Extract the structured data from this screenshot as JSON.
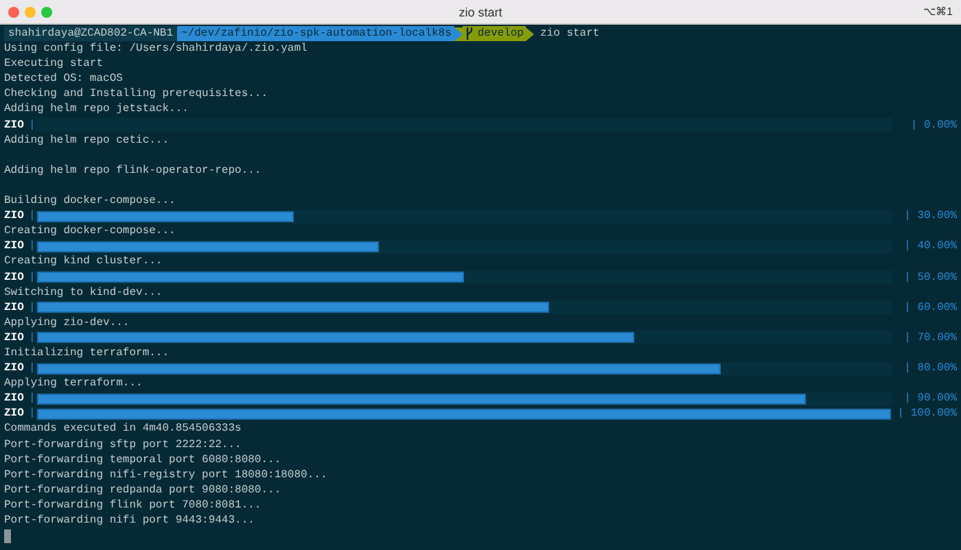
{
  "window": {
    "title": "zio start",
    "shortcut": "⌥⌘1"
  },
  "prompt": {
    "user": "shahirdaya@ZCAD802-CA-NB1",
    "path": "~/dev/zafinio/zio-spk-automation-localk8s",
    "branch": "develop",
    "command": "zio start"
  },
  "lines": [
    {
      "kind": "text",
      "text": "Using config file: /Users/shahirdaya/.zio.yaml"
    },
    {
      "kind": "text",
      "text": "Executing start"
    },
    {
      "kind": "text",
      "text": "Detected OS: macOS"
    },
    {
      "kind": "text",
      "text": "Checking and Installing prerequisites..."
    },
    {
      "kind": "text",
      "text": "Adding helm repo jetstack..."
    },
    {
      "kind": "progress",
      "label": "ZIO",
      "open": "|",
      "level": 0,
      "reading": "| 0.00%"
    },
    {
      "kind": "text",
      "text": "Adding helm repo cetic..."
    },
    {
      "kind": "blank"
    },
    {
      "kind": "text",
      "text": "Adding helm repo flink-operator-repo..."
    },
    {
      "kind": "blank"
    },
    {
      "kind": "text",
      "text": "Building docker-compose..."
    },
    {
      "kind": "progress",
      "label": "ZIO",
      "open": "|",
      "level": 0.3,
      "reading": "| 30.00%"
    },
    {
      "kind": "text",
      "text": "Creating docker-compose..."
    },
    {
      "kind": "progress",
      "label": "ZIO",
      "open": "|",
      "level": 0.4,
      "reading": "| 40.00%"
    },
    {
      "kind": "text",
      "text": "Creating kind cluster..."
    },
    {
      "kind": "progress",
      "label": "ZIO",
      "open": "|",
      "level": 0.5,
      "reading": "| 50.00%"
    },
    {
      "kind": "text",
      "text": "Switching to kind-dev..."
    },
    {
      "kind": "progress",
      "label": "ZIO",
      "open": "|",
      "level": 0.6,
      "reading": "| 60.00%"
    },
    {
      "kind": "text",
      "text": "Applying zio-dev..."
    },
    {
      "kind": "progress",
      "label": "ZIO",
      "open": "|",
      "level": 0.7,
      "reading": "| 70.00%"
    },
    {
      "kind": "text",
      "text": "Initializing terraform..."
    },
    {
      "kind": "progress",
      "label": "ZIO",
      "open": "|",
      "level": 0.8,
      "reading": "| 80.00%"
    },
    {
      "kind": "text",
      "text": "Applying terraform..."
    },
    {
      "kind": "progress",
      "label": "ZIO",
      "open": "|",
      "level": 0.9,
      "reading": "| 90.00%"
    },
    {
      "kind": "progress",
      "label": "ZIO",
      "open": "|",
      "level": 1,
      "reading": "| 100.00%"
    },
    {
      "kind": "text",
      "text": "Commands executed in 4m40.854506333s"
    },
    {
      "kind": "text",
      "text": "Port-forwarding sftp port 2222:22..."
    },
    {
      "kind": "text",
      "text": "Port-forwarding temporal port 6080:8080..."
    },
    {
      "kind": "text",
      "text": "Port-forwarding nifi-registry port 18080:18080..."
    },
    {
      "kind": "text",
      "text": "Port-forwarding redpanda port 9080:8080..."
    },
    {
      "kind": "text",
      "text": "Port-forwarding flink port 7080:8081..."
    },
    {
      "kind": "text",
      "text": "Port-forwarding nifi port 9443:9443..."
    }
  ]
}
